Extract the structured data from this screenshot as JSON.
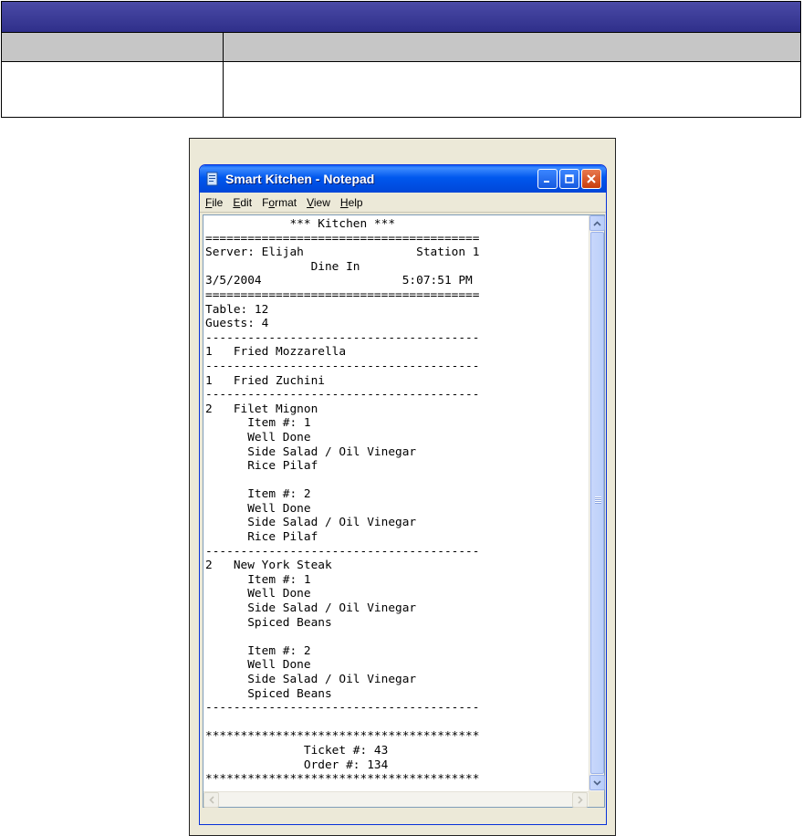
{
  "window": {
    "title": "Smart Kitchen - Notepad",
    "icons": [
      "notepad-icon",
      "minimize-icon",
      "maximize-icon",
      "close-icon"
    ]
  },
  "menu": [
    "File",
    "Edit",
    "Format",
    "View",
    "Help"
  ],
  "receipt": {
    "lines": [
      "            *** Kitchen ***",
      "=======================================",
      "Server: Elijah                Station 1",
      "               Dine In",
      "3/5/2004                    5:07:51 PM",
      "=======================================",
      "Table: 12",
      "Guests: 4",
      "---------------------------------------",
      "1   Fried Mozzarella",
      "---------------------------------------",
      "1   Fried Zuchini",
      "---------------------------------------",
      "2   Filet Mignon",
      "      Item #: 1",
      "      Well Done",
      "      Side Salad / Oil Vinegar",
      "      Rice Pilaf",
      "",
      "      Item #: 2",
      "      Well Done",
      "      Side Salad / Oil Vinegar",
      "      Rice Pilaf",
      "---------------------------------------",
      "2   New York Steak",
      "      Item #: 1",
      "      Well Done",
      "      Side Salad / Oil Vinegar",
      "      Spiced Beans",
      "",
      "      Item #: 2",
      "      Well Done",
      "      Side Salad / Oil Vinegar",
      "      Spiced Beans",
      "---------------------------------------",
      "",
      "***************************************",
      "              Ticket #: 43",
      "              Order #: 134",
      "***************************************"
    ]
  },
  "colors": {
    "doc_title_bar": "#2f2f8a",
    "doc_header_row": "#c6c6c6",
    "xp_titlebar": "#0058ee",
    "xp_close": "#c83c0c"
  }
}
